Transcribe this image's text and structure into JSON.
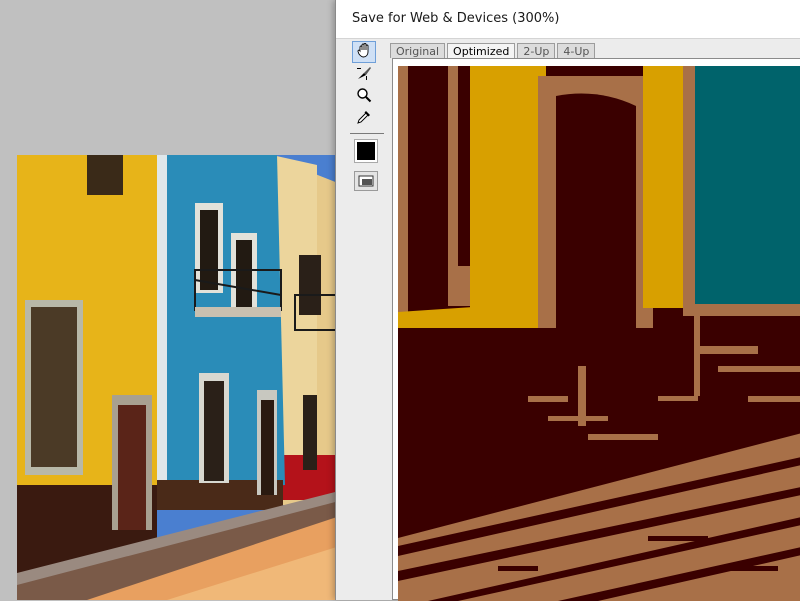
{
  "window": {
    "title": "Save for Web & Devices (300%)"
  },
  "tools": [
    {
      "icon": "hand-icon",
      "name": "Hand Tool"
    },
    {
      "icon": "slice-select-icon",
      "name": "Slice Select Tool"
    },
    {
      "icon": "zoom-icon",
      "name": "Zoom Tool"
    },
    {
      "icon": "eyedropper-icon",
      "name": "Eyedropper Tool"
    }
  ],
  "eyedropper_color": "#000000",
  "tabs": [
    {
      "label": "Original",
      "selected": false
    },
    {
      "label": "Optimized",
      "selected": true
    },
    {
      "label": "2-Up",
      "selected": false
    },
    {
      "label": "4-Up",
      "selected": false
    }
  ],
  "palette": {
    "dark_maroon": "#3a0000",
    "yellow": "#d8a000",
    "teal": "#00636b",
    "tan": "#a87048"
  }
}
